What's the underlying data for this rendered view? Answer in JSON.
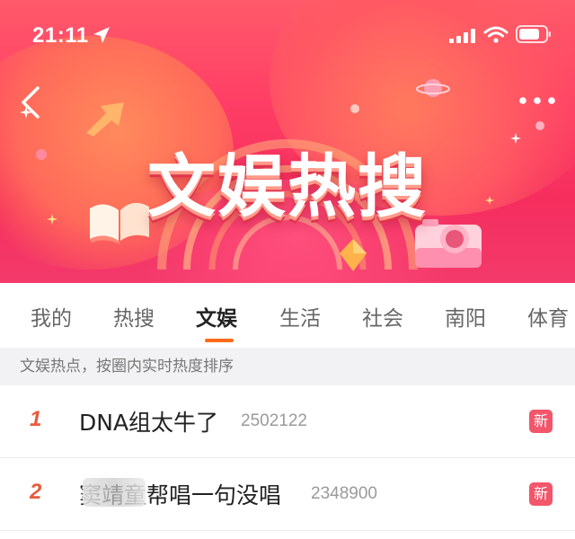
{
  "status_bar": {
    "time": "21:11",
    "icons": [
      "location-arrow-icon",
      "signal-icon",
      "wifi-icon",
      "battery-icon"
    ]
  },
  "header": {
    "title": "文娱热搜",
    "back_icon": "back-chevron-icon",
    "more_icon": "more-dots-icon",
    "banner_colors": {
      "primary": "#ff3f66",
      "secondary": "#ff7a5e"
    }
  },
  "tabs": [
    {
      "label": "我的",
      "active": false
    },
    {
      "label": "热搜",
      "active": false
    },
    {
      "label": "文娱",
      "active": true
    },
    {
      "label": "生活",
      "active": false
    },
    {
      "label": "社会",
      "active": false
    },
    {
      "label": "南阳",
      "active": false
    },
    {
      "label": "体育",
      "active": false
    }
  ],
  "accent_color": "#ff6a1a",
  "subtitle": "文娱热点，按圈内实时热度排序",
  "list": [
    {
      "rank": "1",
      "title": "DNA组太牛了",
      "count": "2502122",
      "badge": "新"
    },
    {
      "rank": "2",
      "title": "窦靖童帮唱一句没唱",
      "count": "2348900",
      "badge": "新"
    }
  ]
}
